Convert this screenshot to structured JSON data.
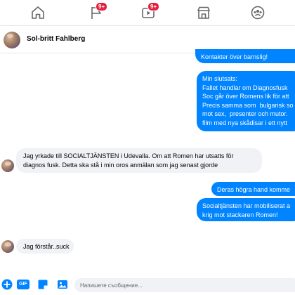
{
  "navbar": {
    "items": [
      {
        "icon": "home-icon"
      },
      {
        "icon": "flag-icon",
        "badge": "9+"
      },
      {
        "icon": "watch-icon",
        "badge": "9+"
      },
      {
        "icon": "marketplace-icon"
      },
      {
        "icon": "groups-icon"
      }
    ]
  },
  "chat": {
    "contact_name": "Sol-britt Fahlberg",
    "messages": {
      "out1": "Kontakter över barnslig!",
      "out2": "Min slutsats:\nFallet handlar om Diagnosfusk\nSoc går över Romens lik för att\nPrecis samma som  bulgarisk so\nmot sex,  presenter och mutor.\nfilm med nya skådisar i ett nytt",
      "in1": "Jag yrkade till SOCIALTJÄNSTEN i Udevalla. Om att Romen har utsatts för\ndiagnos fusk. Detta ska stå i min oros anmälan som jag senast gjorde",
      "out3": "Deras högra hand komme",
      "out4": "Socialtjänsten har mobiliserat a\nkrig mot stackaren Romen!",
      "in2": "Jag förstår..suck"
    }
  },
  "composer": {
    "gif_label": "GIF",
    "placeholder": "Напишете съобщение...",
    "value": ""
  },
  "colors": {
    "accent": "#0084ff",
    "incoming_bg": "#f0f2f5",
    "badge": "#e41e3f"
  }
}
